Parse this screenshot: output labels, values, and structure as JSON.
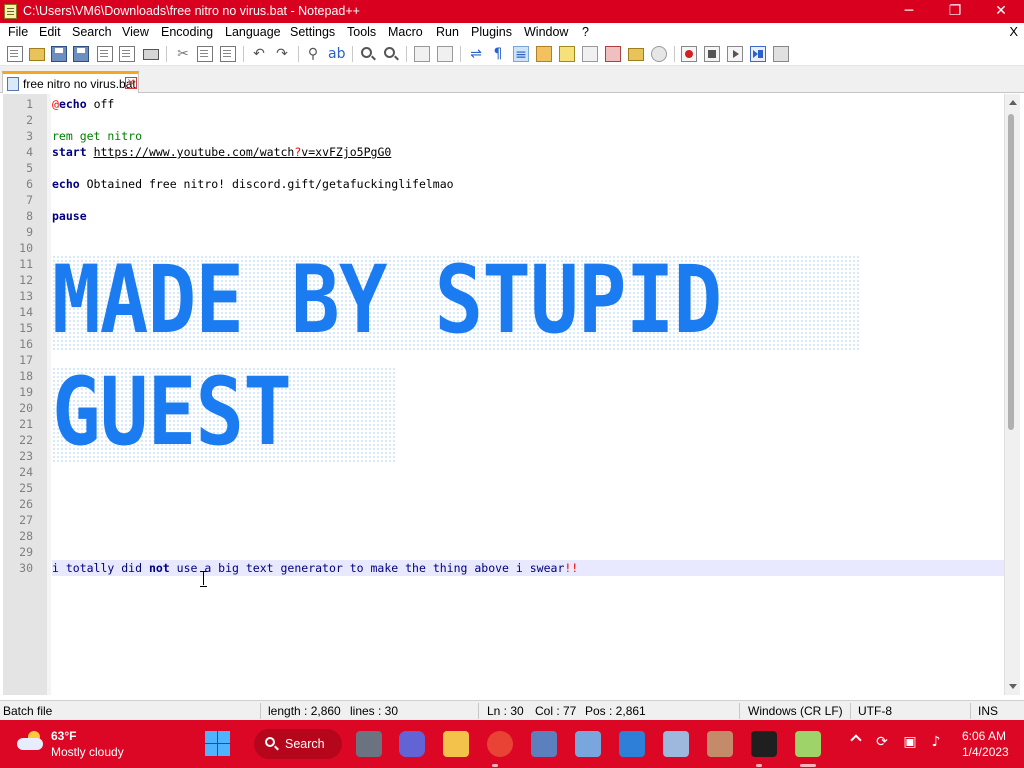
{
  "window": {
    "title": "C:\\Users\\VM6\\Downloads\\free nitro no virus.bat - Notepad++",
    "minimize_glyph": "─",
    "maximize_glyph": "❐",
    "close_glyph": "✕"
  },
  "menu": {
    "items": [
      "File",
      "Edit",
      "Search",
      "View",
      "Encoding",
      "Language",
      "Settings",
      "Tools",
      "Macro",
      "Run",
      "Plugins",
      "Window",
      "?"
    ],
    "close_doc": "X"
  },
  "tab": {
    "label": "free nitro no virus.bat",
    "close_glyph": "×"
  },
  "editor": {
    "line_numbers": [
      "1",
      "2",
      "3",
      "4",
      "5",
      "6",
      "7",
      "8",
      "9",
      "10",
      "11",
      "12",
      "13",
      "14",
      "15",
      "16",
      "17",
      "18",
      "19",
      "20",
      "21",
      "22",
      "23",
      "24",
      "25",
      "26",
      "27",
      "28",
      "29",
      "30"
    ],
    "line1": {
      "at": "@",
      "cmd": "echo",
      "rest": " off"
    },
    "line3": {
      "comment": "rem get nitro"
    },
    "line4": {
      "cmd": "start",
      "url_a": "https://www.youtube.com/watch",
      "q": "?",
      "url_b": "v=xvFZjo5PgG0"
    },
    "line6": {
      "cmd": "echo",
      "rest": " Obtained free nitro! discord.gift/getafuckinglifelmao"
    },
    "line8": {
      "cmd": "pause"
    },
    "banner_line1": "MADE BY STUPID",
    "banner_line2": "GUEST",
    "line30": {
      "p1": "i totally did ",
      "kw": "not",
      "p2": " use a big text generator to make the thing above i swear",
      "bang": "!!"
    }
  },
  "statusbar": {
    "language": "Batch file",
    "length": "length : 2,860",
    "lines": "lines : 30",
    "ln": "Ln : 30",
    "col": "Col : 77",
    "pos": "Pos : 2,861",
    "eol": "Windows (CR LF)",
    "encoding": "UTF-8",
    "mode": "INS"
  },
  "taskbar": {
    "weather_temp": "63°F",
    "weather_desc": "Mostly cloudy",
    "search_label": "Search",
    "time": "6:06 AM",
    "date": "1/4/2023"
  },
  "colors": {
    "title_bar": "#d9001f",
    "taskbar": "#dc0724",
    "banner_blue": "#1a7cf0",
    "current_line": "#e8e8ff"
  }
}
